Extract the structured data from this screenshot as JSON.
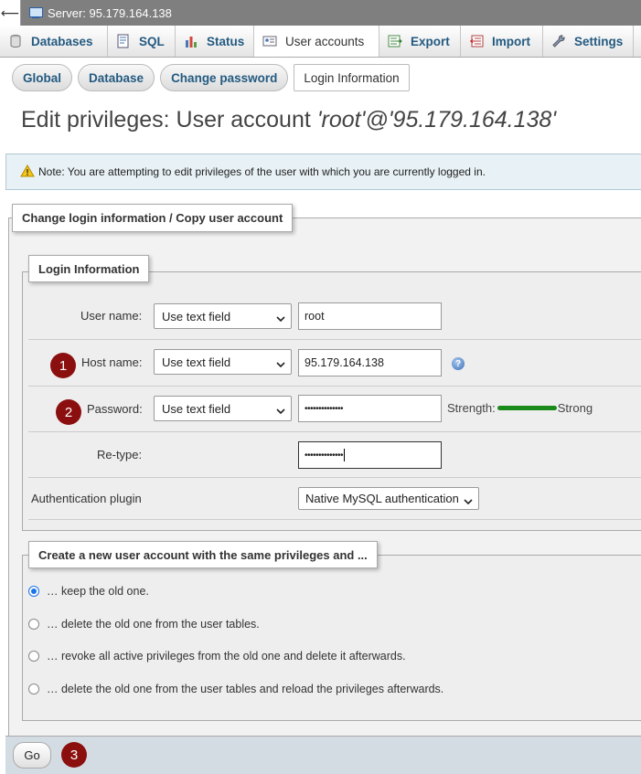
{
  "topbar": {
    "back_glyph": "⟵",
    "server_label": "Server: 95.179.164.138",
    "server_icon": "server-icon"
  },
  "tabs": [
    {
      "label": "Databases",
      "icon": "database-icon"
    },
    {
      "label": "SQL",
      "icon": "sql-icon"
    },
    {
      "label": "Status",
      "icon": "status-icon"
    },
    {
      "label": "User accounts",
      "icon": "user-accounts-icon",
      "active": true
    },
    {
      "label": "Export",
      "icon": "export-icon"
    },
    {
      "label": "Import",
      "icon": "import-icon"
    },
    {
      "label": "Settings",
      "icon": "settings-icon"
    }
  ],
  "subtabs": [
    "Global",
    "Database",
    "Change password",
    "Login Information"
  ],
  "page_title": {
    "prefix": "Edit privileges: User account ",
    "account": "'root'@'95.179.164.138'"
  },
  "notice": "Note: You are attempting to edit privileges of the user with which you are currently logged in.",
  "fieldset_outer_legend": "Change login information / Copy user account",
  "login_info": {
    "legend": "Login Information",
    "user_name": {
      "label": "User name:",
      "mode": "Use text field",
      "value": "root"
    },
    "host_name": {
      "label": "Host name:",
      "mode": "Use text field",
      "value": "95.179.164.138"
    },
    "password": {
      "label": "Password:",
      "mode": "Use text field",
      "value": "••••••••••••••",
      "strength_label": "Strength:",
      "strength_value": "Strong"
    },
    "retype": {
      "label": "Re-type:",
      "value": "••••••••••••••"
    },
    "auth_plugin": {
      "label": "Authentication plugin",
      "value": "Native MySQL authentication"
    }
  },
  "copy_options": {
    "legend": "Create a new user account with the same privileges and ...",
    "options": [
      {
        "label": "… keep the old one.",
        "selected": true
      },
      {
        "label": "… delete the old one from the user tables.",
        "selected": false
      },
      {
        "label": "… revoke all active privileges from the old one and delete it afterwards.",
        "selected": false
      },
      {
        "label": "… delete the old one from the user tables and reload the privileges afterwards.",
        "selected": false
      }
    ]
  },
  "go_button": "Go",
  "badges": [
    "1",
    "2",
    "3"
  ],
  "colors": {
    "link_blue": "#235a81",
    "badge_red": "#8b0f0f",
    "strength_green": "#1a8a1a",
    "footer_bg": "#d3dce3",
    "notice_bg": "#e8f1f5"
  }
}
